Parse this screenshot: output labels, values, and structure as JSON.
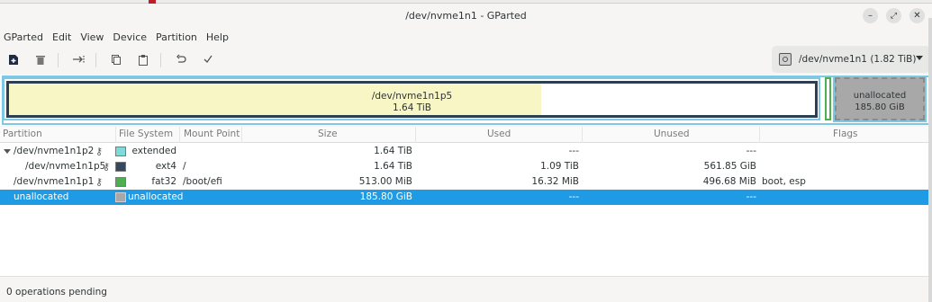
{
  "window": {
    "title": "/dev/nvme1n1 - GParted"
  },
  "menu": [
    "GParted",
    "Edit",
    "View",
    "Device",
    "Partition",
    "Help"
  ],
  "toolbar": {
    "icons": [
      "new-partition-icon",
      "delete-icon",
      "resize-move-icon",
      "copy-icon",
      "paste-icon",
      "undo-icon",
      "apply-icon"
    ]
  },
  "device": {
    "label": "/dev/nvme1n1  (1.82 TiB)"
  },
  "visual": {
    "p5": {
      "name": "/dev/nvme1n1p5",
      "size": "1.64 TiB",
      "used_fraction": 0.66
    },
    "unallocated": {
      "name": "unallocated",
      "size": "185.80 GiB"
    }
  },
  "table": {
    "headers": [
      "Partition",
      "File System",
      "Mount Point",
      "Size",
      "Used",
      "Unused",
      "Flags"
    ],
    "rows": [
      {
        "partition": "/dev/nvme1n1p2",
        "fs": "extended",
        "mount": "",
        "size": "1.64 TiB",
        "used": "---",
        "unused": "---",
        "flags": "",
        "color": "#7fdbda",
        "key": true
      },
      {
        "partition": "/dev/nvme1n1p5",
        "fs": "ext4",
        "mount": "/",
        "size": "1.64 TiB",
        "used": "1.09 TiB",
        "unused": "561.85 GiB",
        "flags": "",
        "color": "#34495e",
        "key": true
      },
      {
        "partition": "/dev/nvme1n1p1",
        "fs": "fat32",
        "mount": "/boot/efi",
        "size": "513.00 MiB",
        "used": "16.32 MiB",
        "unused": "496.68 MiB",
        "flags": "boot, esp",
        "color": "#4caf50",
        "key": true
      },
      {
        "partition": "unallocated",
        "fs": "unallocated",
        "mount": "",
        "size": "185.80 GiB",
        "used": "---",
        "unused": "---",
        "flags": "",
        "color": "#a8a8a8",
        "key": false
      }
    ]
  },
  "status": {
    "text": "0 operations pending"
  }
}
